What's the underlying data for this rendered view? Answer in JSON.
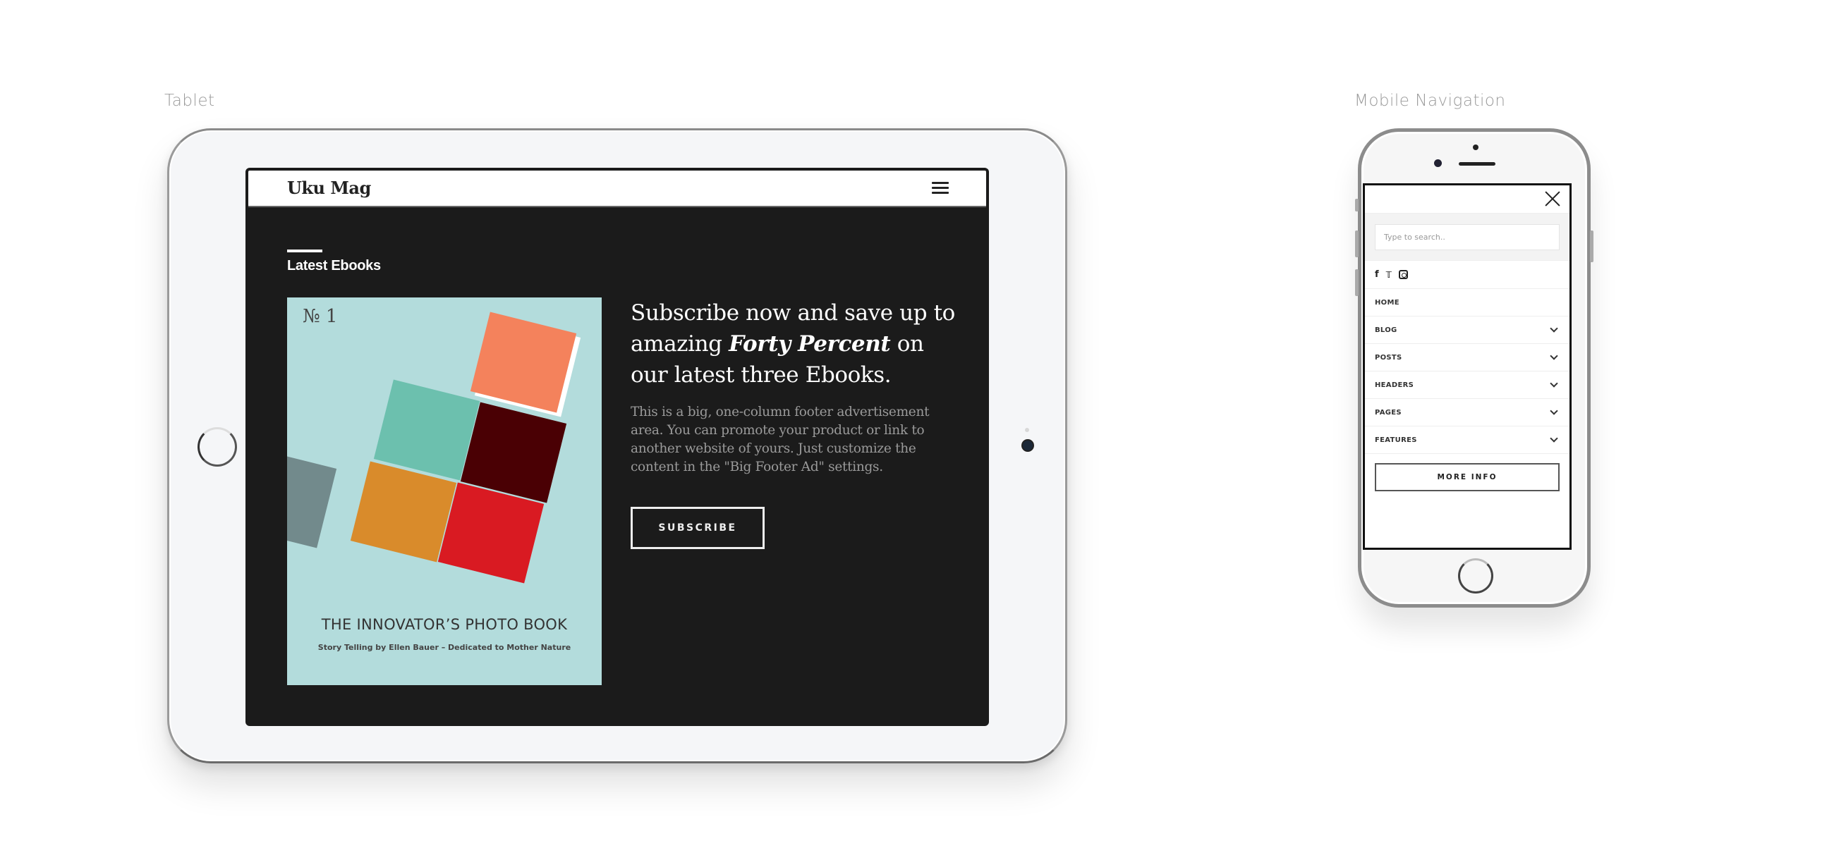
{
  "labels": {
    "tablet": "Tablet",
    "mobile": "Mobile Navigation"
  },
  "tablet": {
    "site_title": "Uku Mag",
    "menu_icon": "hamburger-menu-icon",
    "section_title": "Latest Ebooks",
    "cover": {
      "number": "№ 1",
      "title": "THE INNOVATOR’S PHOTO BOOK",
      "subtitle": "Story Telling by Ellen Bauer – Dedicated to Mother Nature",
      "background_color": "#b3dcdc",
      "square_colors": [
        "#f4825c",
        "#6cc0ae",
        "#4a0004",
        "#728a8c",
        "#d98b2b",
        "#d91a22"
      ]
    },
    "promo": {
      "heading_before": "Subscribe now and save up to amazing ",
      "heading_emphasis": "Forty Percent",
      "heading_after": " on our latest three Ebooks.",
      "body": "This is a big, one-column footer advertisement area. You can promote your product or link to another website of yours. Just customize the content in the \"Big Footer Ad\" settings.",
      "button_label": "SUBSCRIBE"
    }
  },
  "mobile": {
    "close_icon": "close-icon",
    "search_placeholder": "Type to search..",
    "social": {
      "facebook": "f",
      "twitter": "🐦"
    },
    "nav_items": [
      {
        "label": "HOME",
        "has_submenu": false
      },
      {
        "label": "BLOG",
        "has_submenu": true
      },
      {
        "label": "POSTS",
        "has_submenu": true
      },
      {
        "label": "HEADERS",
        "has_submenu": true
      },
      {
        "label": "PAGES",
        "has_submenu": true
      },
      {
        "label": "FEATURES",
        "has_submenu": true
      }
    ],
    "more_info_label": "MORE INFO"
  }
}
